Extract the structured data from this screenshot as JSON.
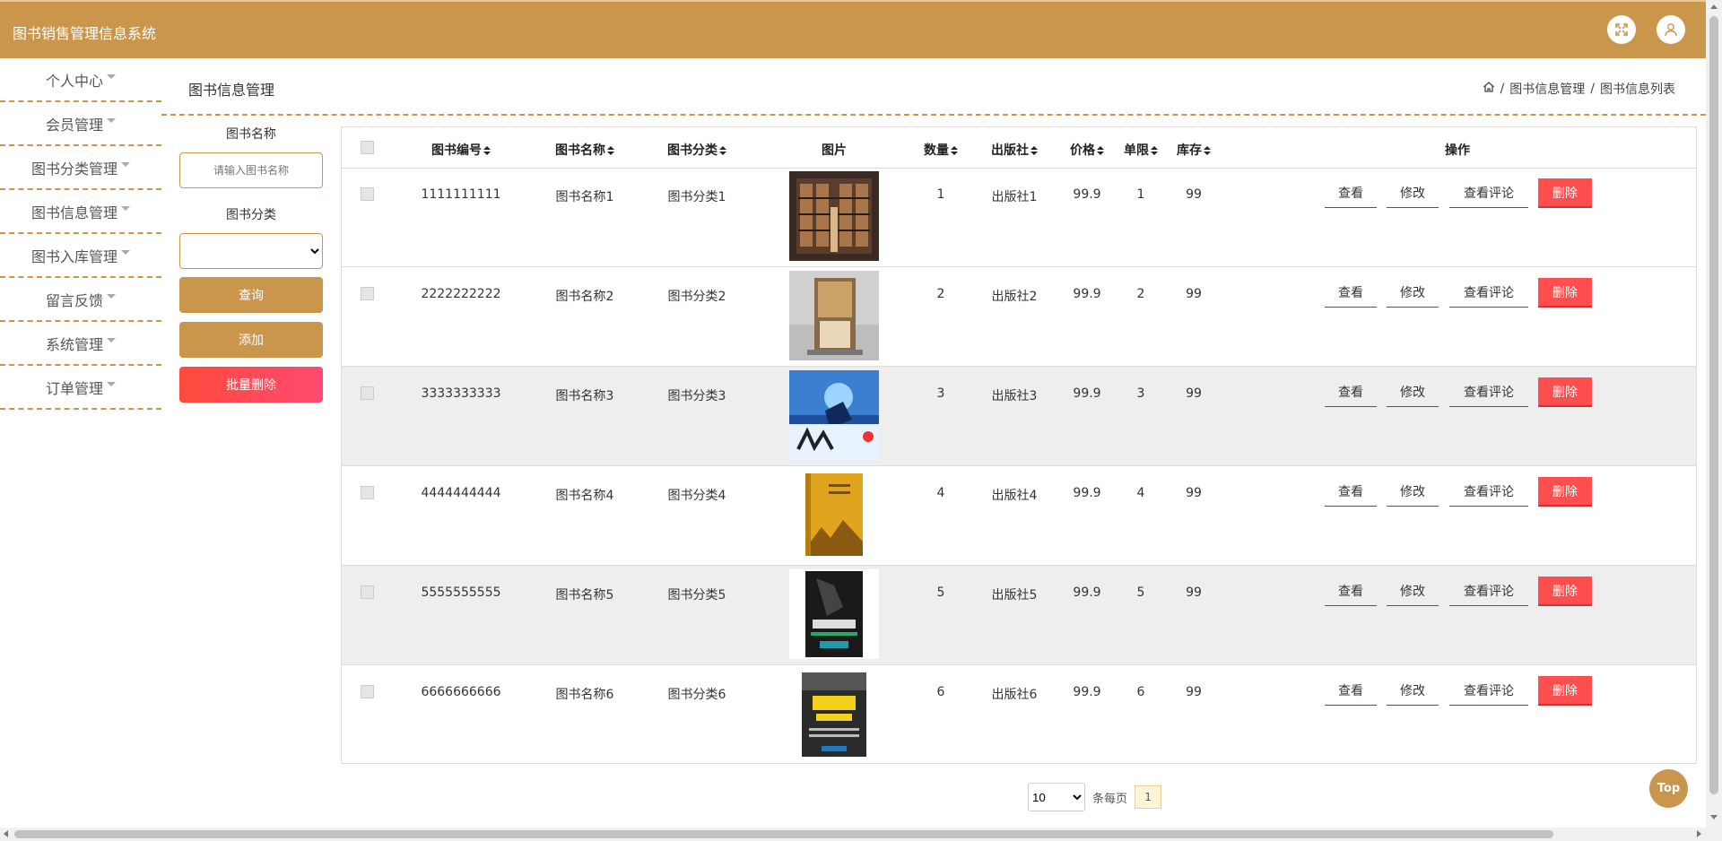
{
  "app_title": "图书销售管理信息系统",
  "sidebar": {
    "items": [
      {
        "label": "个人中心"
      },
      {
        "label": "会员管理"
      },
      {
        "label": "图书分类管理"
      },
      {
        "label": "图书信息管理"
      },
      {
        "label": "图书入库管理"
      },
      {
        "label": "留言反馈"
      },
      {
        "label": "系统管理"
      },
      {
        "label": "订单管理"
      }
    ]
  },
  "page": {
    "title": "图书信息管理",
    "breadcrumb": [
      "图书信息管理",
      "图书信息列表"
    ]
  },
  "search": {
    "name_label": "图书名称",
    "name_placeholder": "请输入图书名称",
    "category_label": "图书分类",
    "query_button": "查询",
    "add_button": "添加",
    "batch_delete_button": "批量删除"
  },
  "table": {
    "headers": {
      "code": "图书编号",
      "name": "图书名称",
      "category": "图书分类",
      "image": "图片",
      "qty": "数量",
      "publisher": "出版社",
      "price": "价格",
      "limit": "单限",
      "stock": "库存",
      "actions": "操作"
    },
    "action_labels": {
      "view": "查看",
      "edit": "修改",
      "comments": "查看评论",
      "delete": "删除"
    },
    "rows": [
      {
        "code": "1111111111",
        "name": "图书名称1",
        "category": "图书分类1",
        "qty": "1",
        "publisher": "出版社1",
        "price": "99.9",
        "limit": "1",
        "stock": "99"
      },
      {
        "code": "2222222222",
        "name": "图书名称2",
        "category": "图书分类2",
        "qty": "2",
        "publisher": "出版社2",
        "price": "99.9",
        "limit": "2",
        "stock": "99"
      },
      {
        "code": "3333333333",
        "name": "图书名称3",
        "category": "图书分类3",
        "qty": "3",
        "publisher": "出版社3",
        "price": "99.9",
        "limit": "3",
        "stock": "99"
      },
      {
        "code": "4444444444",
        "name": "图书名称4",
        "category": "图书分类4",
        "qty": "4",
        "publisher": "出版社4",
        "price": "99.9",
        "limit": "4",
        "stock": "99"
      },
      {
        "code": "5555555555",
        "name": "图书名称5",
        "category": "图书分类5",
        "qty": "5",
        "publisher": "出版社5",
        "price": "99.9",
        "limit": "5",
        "stock": "99"
      },
      {
        "code": "6666666666",
        "name": "图书名称6",
        "category": "图书分类6",
        "qty": "6",
        "publisher": "出版社6",
        "price": "99.9",
        "limit": "6",
        "stock": "99"
      }
    ]
  },
  "pagination": {
    "page_size": "10",
    "per_page_label": "条每页",
    "current_page": "1"
  },
  "top_button": "Top",
  "colors": {
    "brand": "#c9964c",
    "danger": "#ff4e4e",
    "batch_delete": "#ff4756"
  },
  "icons": [
    "fullscreen-icon",
    "user-icon",
    "home-icon",
    "sort-icon",
    "book-cover-image"
  ]
}
